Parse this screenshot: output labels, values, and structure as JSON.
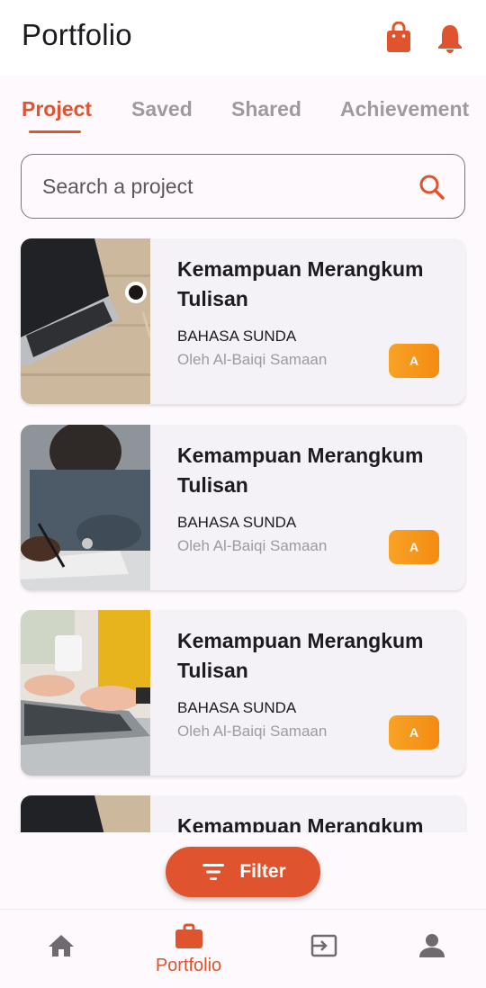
{
  "header": {
    "title": "Portfolio",
    "icons": [
      "shopping-bag-icon",
      "bell-icon"
    ]
  },
  "tabs": [
    {
      "label": "Project",
      "active": true
    },
    {
      "label": "Saved",
      "active": false
    },
    {
      "label": "Shared",
      "active": false
    },
    {
      "label": "Achievement",
      "active": false
    }
  ],
  "search": {
    "placeholder": "Search a project",
    "icon": "search-icon"
  },
  "projects": [
    {
      "title": "Kemampuan Merangkum Tulisan",
      "subject": "BAHASA SUNDA",
      "author": "Oleh Al-Baiqi Samaan",
      "grade": "A"
    },
    {
      "title": "Kemampuan Merangkum Tulisan",
      "subject": "BAHASA SUNDA",
      "author": "Oleh Al-Baiqi Samaan",
      "grade": "A"
    },
    {
      "title": "Kemampuan Merangkum Tulisan",
      "subject": "BAHASA SUNDA",
      "author": "Oleh Al-Baiqi Samaan",
      "grade": "A"
    },
    {
      "title": "Kemampuan Merangkum",
      "subject": "",
      "author": "",
      "grade": ""
    }
  ],
  "filter": {
    "label": "Filter",
    "icon": "filter-icon"
  },
  "bottom_nav": [
    {
      "icon": "home-icon",
      "label": "",
      "active": false
    },
    {
      "icon": "briefcase-icon",
      "label": "Portfolio",
      "active": true
    },
    {
      "icon": "input-icon",
      "label": "",
      "active": false
    },
    {
      "icon": "person-icon",
      "label": "",
      "active": false
    }
  ],
  "colors": {
    "accent": "#e0532f",
    "grade_gradient_start": "#f7a326",
    "grade_gradient_end": "#f58a12",
    "inactive": "#9e9a9e",
    "nav_inactive": "#6e6a70"
  }
}
